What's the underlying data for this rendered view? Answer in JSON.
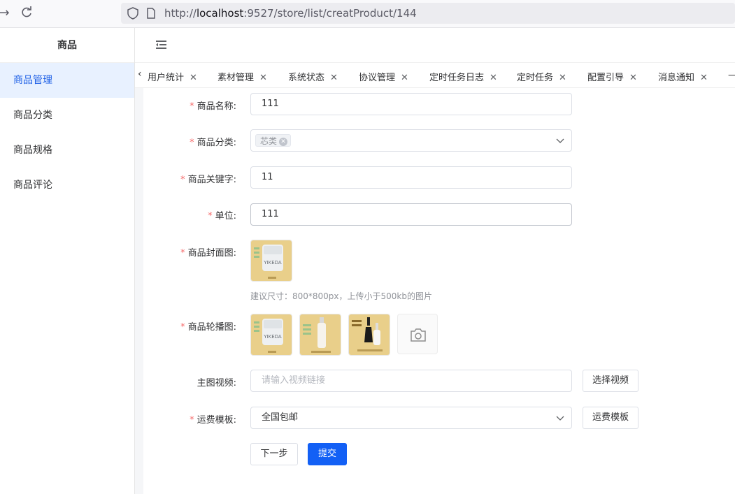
{
  "browser": {
    "url_prefix": "http://",
    "url_host": "localhost",
    "url_rest": ":9527/store/list/creatProduct/144"
  },
  "sidebar": {
    "title": "商品",
    "items": [
      {
        "label": "商品管理",
        "active": true
      },
      {
        "label": "商品分类",
        "active": false
      },
      {
        "label": "商品规格",
        "active": false
      },
      {
        "label": "商品评论",
        "active": false
      }
    ]
  },
  "tabs": [
    {
      "label": "用户统计"
    },
    {
      "label": "素材管理"
    },
    {
      "label": "系统状态"
    },
    {
      "label": "协议管理"
    },
    {
      "label": "定时任务日志"
    },
    {
      "label": "定时任务"
    },
    {
      "label": "配置引导"
    },
    {
      "label": "消息通知"
    }
  ],
  "form": {
    "name": {
      "label": "商品名称:",
      "value": "111",
      "required": true
    },
    "category": {
      "label": "商品分类:",
      "tag": "芯类",
      "required": true
    },
    "keyword": {
      "label": "商品关键字:",
      "value": "11",
      "required": true
    },
    "unit": {
      "label": "单位:",
      "value": "111",
      "required": true
    },
    "cover": {
      "label": "商品封面图:",
      "hint": "建议尺寸：800*800px，上传小于500kb的图片",
      "required": true
    },
    "carousel": {
      "label": "商品轮播图:",
      "required": true
    },
    "video": {
      "label": "主图视频:",
      "placeholder": "请输入视频链接",
      "button": "选择视频"
    },
    "shipping": {
      "label": "运费模板:",
      "value": "全国包邮",
      "button": "运费模板",
      "required": true
    },
    "next_button": "下一步",
    "submit_button": "提交"
  },
  "colors": {
    "primary": "#1360f5",
    "active_menu_bg": "#e8f1ff",
    "required": "#f56c6c"
  }
}
